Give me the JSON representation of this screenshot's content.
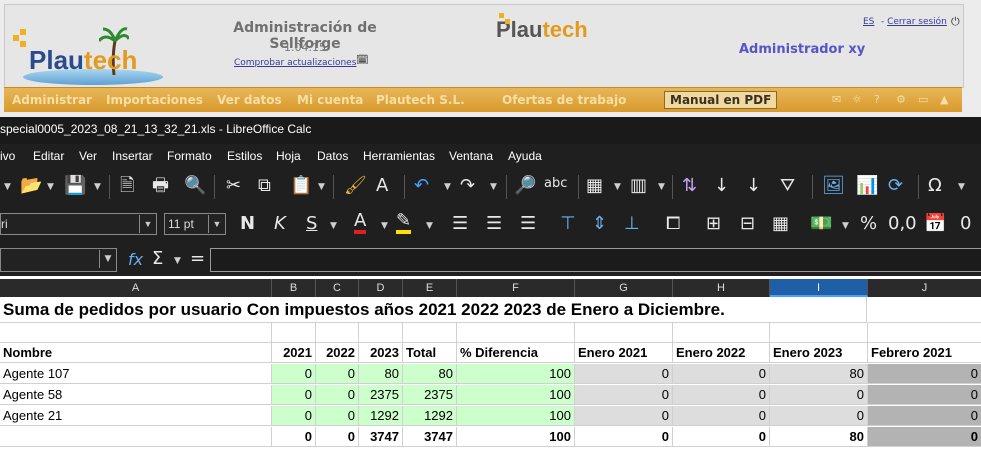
{
  "web": {
    "logo_text_left": "Plau",
    "logo_text_right": "tech",
    "admin_title": "Administración de Sellforge",
    "version": "1.04.15",
    "update_link": "Comprobar actualizaciones",
    "logo2_left": "Plau",
    "logo2_right": "tech",
    "user": "Administrador xy",
    "lang": "ES",
    "logout_prefix": "- ",
    "logout": "Cerrar sesión",
    "nav": [
      "Administrar",
      "Importaciones",
      "Ver datos",
      "Mi cuenta",
      "Plautech S.L.",
      "Ofertas de trabajo"
    ],
    "manual": "Manual en PDF"
  },
  "calc": {
    "window_title": "special0005_2023_08_21_13_32_21.xls - LibreOffice Calc",
    "menu": [
      "ivo",
      "Editar",
      "Ver",
      "Insertar",
      "Formato",
      "Estilos",
      "Hoja",
      "Datos",
      "Herramientas",
      "Ventana",
      "Ayuda"
    ],
    "font_name": "ri",
    "font_size": "11 pt",
    "formula_fx": "fx",
    "formula_sigma": "Σ",
    "formula_eq": "=",
    "columns": [
      "A",
      "B",
      "C",
      "D",
      "E",
      "F",
      "G",
      "H",
      "I",
      "J"
    ],
    "selected_column": "I"
  },
  "sheet": {
    "title": "Suma de pedidos por usuario   Con impuestos  años 2021 2022 2023  de Enero a Diciembre.",
    "headers": [
      "Nombre",
      "2021",
      "2022",
      "2023",
      "Total",
      "% Diferencia",
      "Enero 2021",
      "Enero 2022",
      "Enero 2023",
      "Febrero 2021"
    ],
    "rows": [
      [
        "Agente 107",
        "0",
        "0",
        "80",
        "80",
        "100",
        "0",
        "0",
        "80",
        "0"
      ],
      [
        "Agente 58",
        "0",
        "0",
        "2375",
        "2375",
        "100",
        "0",
        "0",
        "0",
        "0"
      ],
      [
        "Agente 21",
        "0",
        "0",
        "1292",
        "1292",
        "100",
        "0",
        "0",
        "0",
        "0"
      ]
    ],
    "totals": [
      "",
      "0",
      "0",
      "3747",
      "3747",
      "100",
      "0",
      "0",
      "80",
      "0"
    ]
  }
}
